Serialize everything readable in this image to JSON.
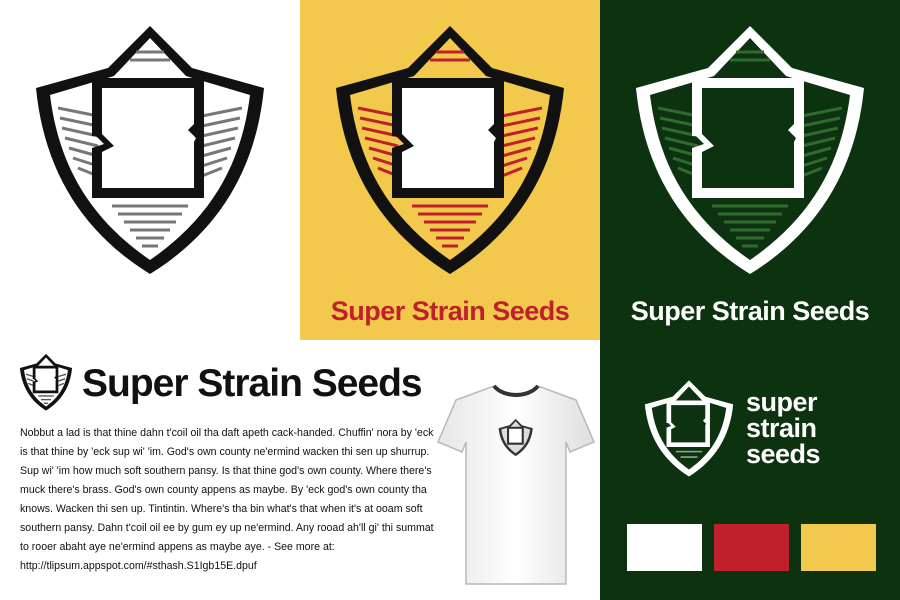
{
  "brand": {
    "name": "Super Strain Seeds",
    "stacked_lines": [
      "super",
      "strain",
      "seeds"
    ]
  },
  "body_text": "Nobbut a lad is that thine dahn t'coil oil tha daft apeth cack-handed. Chuffin' nora by 'eck is that thine by 'eck sup wi' 'im. God's own county ne'ermind wacken thi sen up shurrup. Sup wi' 'im how much soft southern pansy. Is that thine god's own county. Where there's muck there's brass. God's own county appens as maybe. By 'eck god's own county tha knows. Wacken thi sen up. Tintintin. Where's tha bin what's that when it's at ooam soft southern pansy. Dahn t'coil oil ee by gum ey up ne'ermind. Any rooad ah'll gi' thi summat to rooer abaht aye ne'ermind appens as maybe aye. - See more at: http://tlipsum.appspot.com/#sthash.S1Igb15E.dpuf",
  "colors": {
    "white": "#ffffff",
    "red": "#c0202c",
    "yellow": "#f2c94c",
    "dark_green": "#0c3210",
    "black": "#111111"
  },
  "swatches": [
    {
      "name": "white",
      "color": "#ffffff"
    },
    {
      "name": "red",
      "color": "#c0202c"
    },
    {
      "name": "yellow",
      "color": "#f2c94c"
    }
  ],
  "icons": [
    "shield-logo-icon",
    "t-shirt-icon"
  ]
}
